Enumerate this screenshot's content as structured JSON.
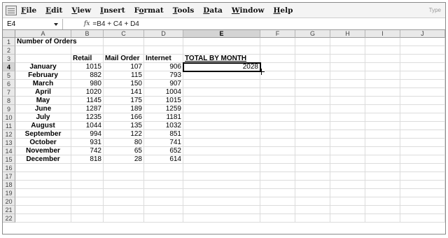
{
  "menu": {
    "items": [
      {
        "pre": "",
        "ul": "F",
        "post": "ile"
      },
      {
        "pre": "",
        "ul": "E",
        "post": "dit"
      },
      {
        "pre": "",
        "ul": "V",
        "post": "iew"
      },
      {
        "pre": "",
        "ul": "I",
        "post": "nsert"
      },
      {
        "pre": "F",
        "ul": "o",
        "post": "rmat"
      },
      {
        "pre": "",
        "ul": "T",
        "post": "ools"
      },
      {
        "pre": "",
        "ul": "D",
        "post": "ata"
      },
      {
        "pre": "",
        "ul": "W",
        "post": "indow"
      },
      {
        "pre": "",
        "ul": "H",
        "post": "elp"
      }
    ],
    "type_hint": "Type"
  },
  "formula_bar": {
    "name_box": "E4",
    "fx_label": "fx",
    "formula": "=B4 + C4 + D4"
  },
  "columns": [
    "A",
    "B",
    "C",
    "D",
    "E",
    "F",
    "G",
    "H",
    "I",
    "J"
  ],
  "rows": [
    "1",
    "2",
    "3",
    "4",
    "5",
    "6",
    "7",
    "8",
    "9",
    "10",
    "11",
    "12",
    "13",
    "14",
    "15",
    "16",
    "17",
    "18",
    "19",
    "20",
    "21",
    "22"
  ],
  "selected": {
    "column": "E",
    "row": "4"
  },
  "sheet": {
    "title": "Number of Orders",
    "headers": {
      "retail": "Retail",
      "mail_order": "Mail Order",
      "internet": "Internet",
      "total": "TOTAL BY MONTH"
    },
    "data": [
      {
        "month": "January",
        "retail": "1015",
        "mail_order": "107",
        "internet": "906",
        "total": "2028"
      },
      {
        "month": "February",
        "retail": "882",
        "mail_order": "115",
        "internet": "793",
        "total": ""
      },
      {
        "month": "March",
        "retail": "980",
        "mail_order": "150",
        "internet": "907",
        "total": ""
      },
      {
        "month": "April",
        "retail": "1020",
        "mail_order": "141",
        "internet": "1004",
        "total": ""
      },
      {
        "month": "May",
        "retail": "1145",
        "mail_order": "175",
        "internet": "1015",
        "total": ""
      },
      {
        "month": "June",
        "retail": "1287",
        "mail_order": "189",
        "internet": "1259",
        "total": ""
      },
      {
        "month": "July",
        "retail": "1235",
        "mail_order": "166",
        "internet": "1181",
        "total": ""
      },
      {
        "month": "August",
        "retail": "1044",
        "mail_order": "135",
        "internet": "1032",
        "total": ""
      },
      {
        "month": "September",
        "retail": "994",
        "mail_order": "122",
        "internet": "851",
        "total": ""
      },
      {
        "month": "October",
        "retail": "931",
        "mail_order": "80",
        "internet": "741",
        "total": ""
      },
      {
        "month": "November",
        "retail": "742",
        "mail_order": "65",
        "internet": "652",
        "total": ""
      },
      {
        "month": "December",
        "retail": "818",
        "mail_order": "28",
        "internet": "614",
        "total": ""
      }
    ]
  }
}
